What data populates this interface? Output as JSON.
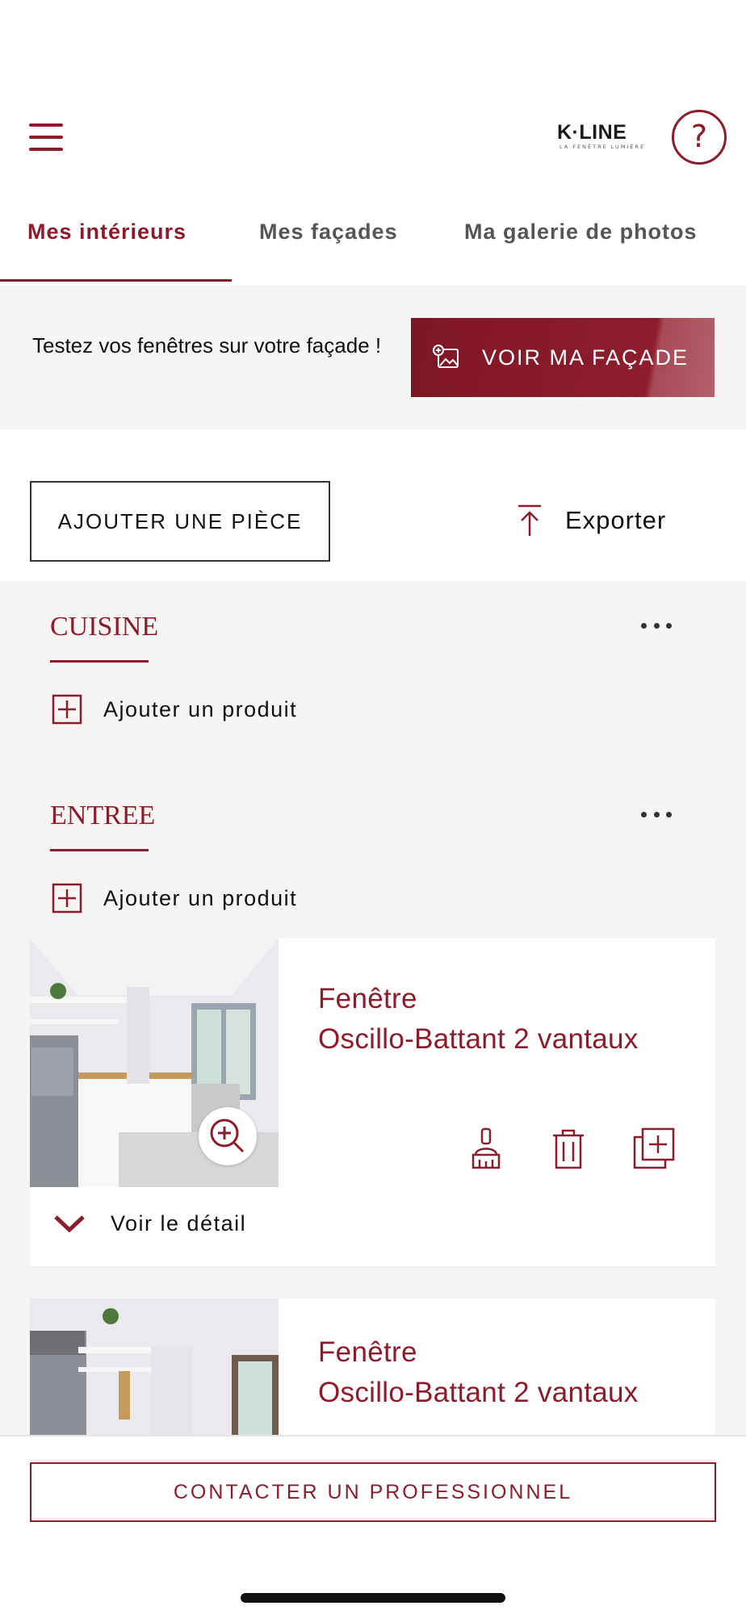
{
  "header": {
    "logo_text": "K·LINE",
    "logo_tagline": "LA FENÊTRE LUMIÈRE",
    "help_label": "?"
  },
  "tabs": [
    {
      "label": "Mes intérieurs",
      "active": true
    },
    {
      "label": "Mes façades",
      "active": false
    },
    {
      "label": "Ma galerie de photos",
      "active": false
    }
  ],
  "promo": {
    "text": "Testez vos fenêtres sur votre façade !",
    "button_label": "VOIR MA FAÇADE"
  },
  "actions": {
    "add_room_label": "AJOUTER UNE PIÈCE",
    "export_label": "Exporter"
  },
  "rooms": [
    {
      "title": "CUISINE",
      "add_product_label": "Ajouter un produit"
    },
    {
      "title": "ENTREE",
      "add_product_label": "Ajouter un produit"
    }
  ],
  "products": [
    {
      "name_line1": "Fenêtre",
      "name_line2": "Oscillo-Battant 2 vantaux",
      "detail_label": "Voir le détail"
    },
    {
      "name_line1": "Fenêtre",
      "name_line2": "Oscillo-Battant 2 vantaux"
    }
  ],
  "footer": {
    "contact_label": "CONTACTER UN PROFESSIONNEL"
  },
  "colors": {
    "brand": "#8c1c2c",
    "background_alt": "#f7f5f4"
  },
  "icons": [
    "menu-icon",
    "help-icon",
    "image-compare-icon",
    "upload-icon",
    "more-icon",
    "plus-square-icon",
    "zoom-in-icon",
    "paint-brush-icon",
    "trash-icon",
    "duplicate-icon",
    "chevron-down-icon"
  ]
}
